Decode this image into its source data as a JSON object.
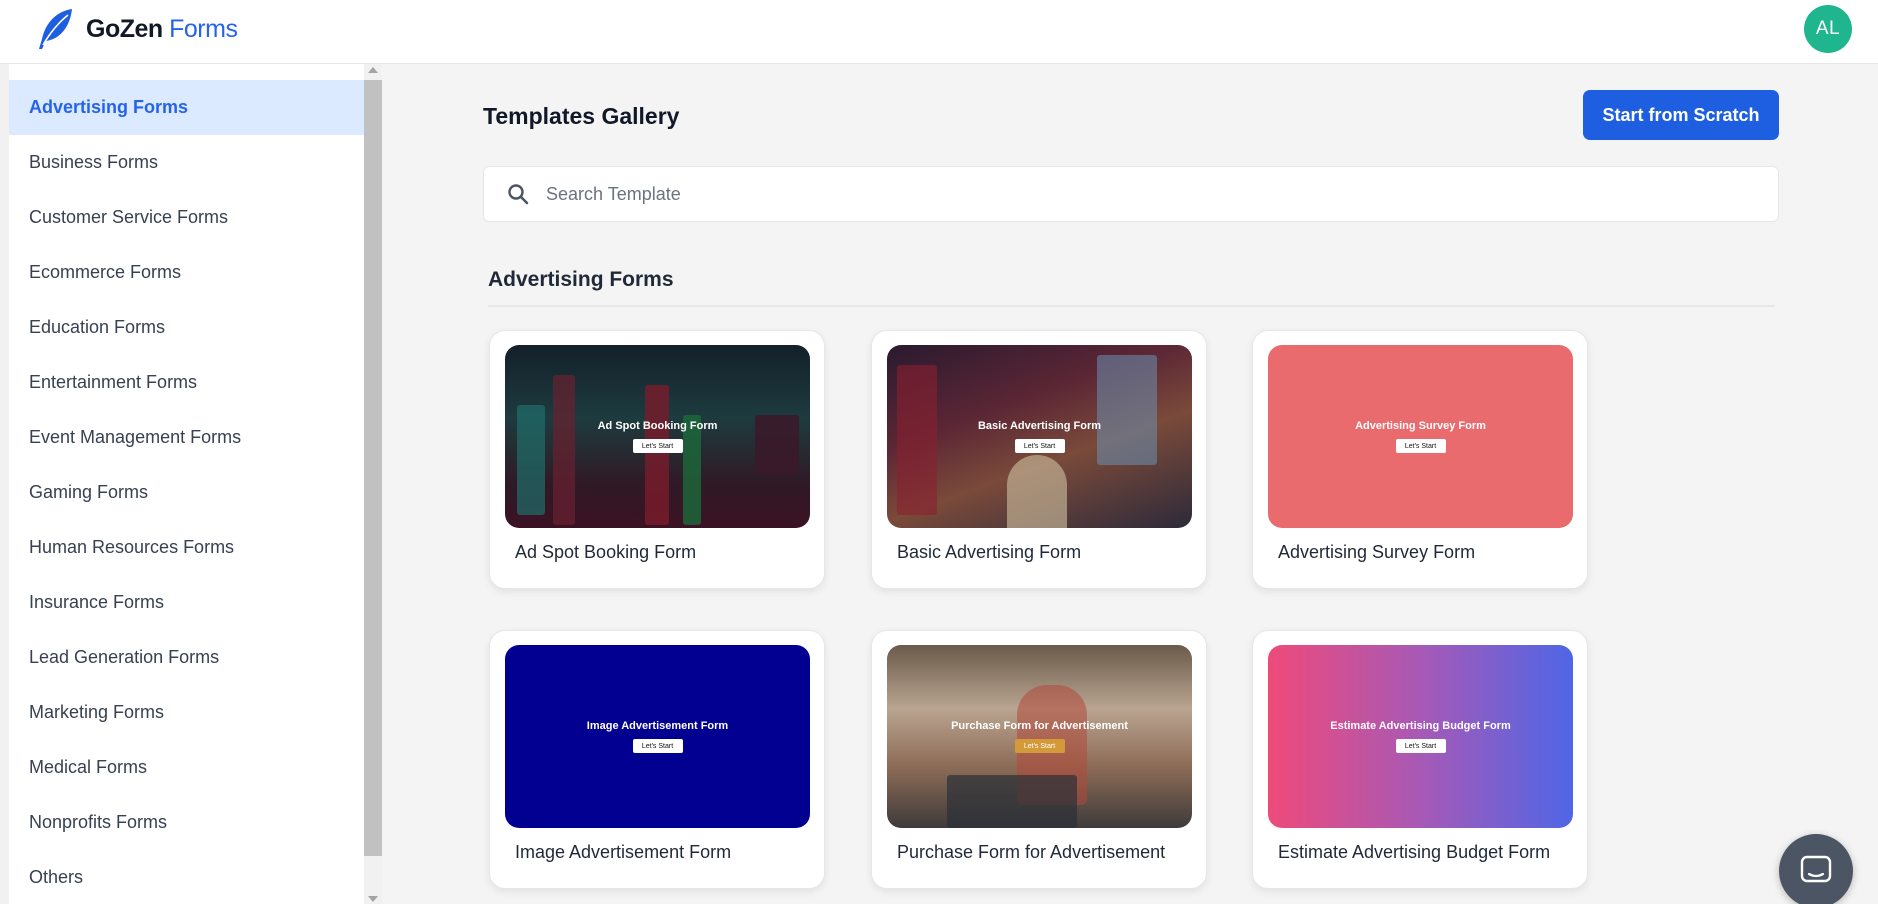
{
  "app": {
    "logo_brand": "GoZen",
    "logo_product": "Forms",
    "avatar_initials": "AL"
  },
  "colors": {
    "accent": "#2563eb",
    "button": "#1d5fe0",
    "avatar": "#1fb58f",
    "active_item_bg": "#dbeafe"
  },
  "sidebar": {
    "active_index": 0,
    "items": [
      "Advertising Forms",
      "Business Forms",
      "Customer Service Forms",
      "Ecommerce Forms",
      "Education Forms",
      "Entertainment Forms",
      "Event Management Forms",
      "Gaming Forms",
      "Human Resources Forms",
      "Insurance Forms",
      "Lead Generation Forms",
      "Marketing Forms",
      "Medical Forms",
      "Nonprofits Forms",
      "Others"
    ]
  },
  "header": {
    "title": "Templates Gallery",
    "scratch_button": "Start from Scratch"
  },
  "search": {
    "placeholder": "Search Template",
    "icon": "search-icon"
  },
  "section": {
    "title": "Advertising Forms"
  },
  "templates": [
    {
      "label": "Ad Spot Booking Form",
      "thumb_title": "Ad Spot Booking Form",
      "thumb_button": "Let's Start",
      "button_color": "#ffffff"
    },
    {
      "label": "Basic Advertising Form",
      "thumb_title": "Basic Advertising Form",
      "thumb_button": "Let's Start",
      "button_color": "#ffffff"
    },
    {
      "label": "Advertising Survey Form",
      "thumb_title": "Advertising Survey Form",
      "thumb_button": "Let's Start",
      "button_color": "#ffffff"
    },
    {
      "label": "Image Advertisement Form",
      "thumb_title": "Image Advertisement Form",
      "thumb_button": "Let's Start",
      "button_color": "#ffffff"
    },
    {
      "label": "Purchase Form for Advertisement",
      "thumb_title": "Purchase Form for Advertisement",
      "thumb_button": "Let's Start",
      "button_color": "#d49a3a"
    },
    {
      "label": "Estimate Advertising Budget Form",
      "thumb_title": "Estimate Advertising Budget Form",
      "thumb_button": "Let's Start",
      "button_color": "#ffffff"
    }
  ],
  "chat": {
    "icon": "chat-bubble-icon"
  }
}
